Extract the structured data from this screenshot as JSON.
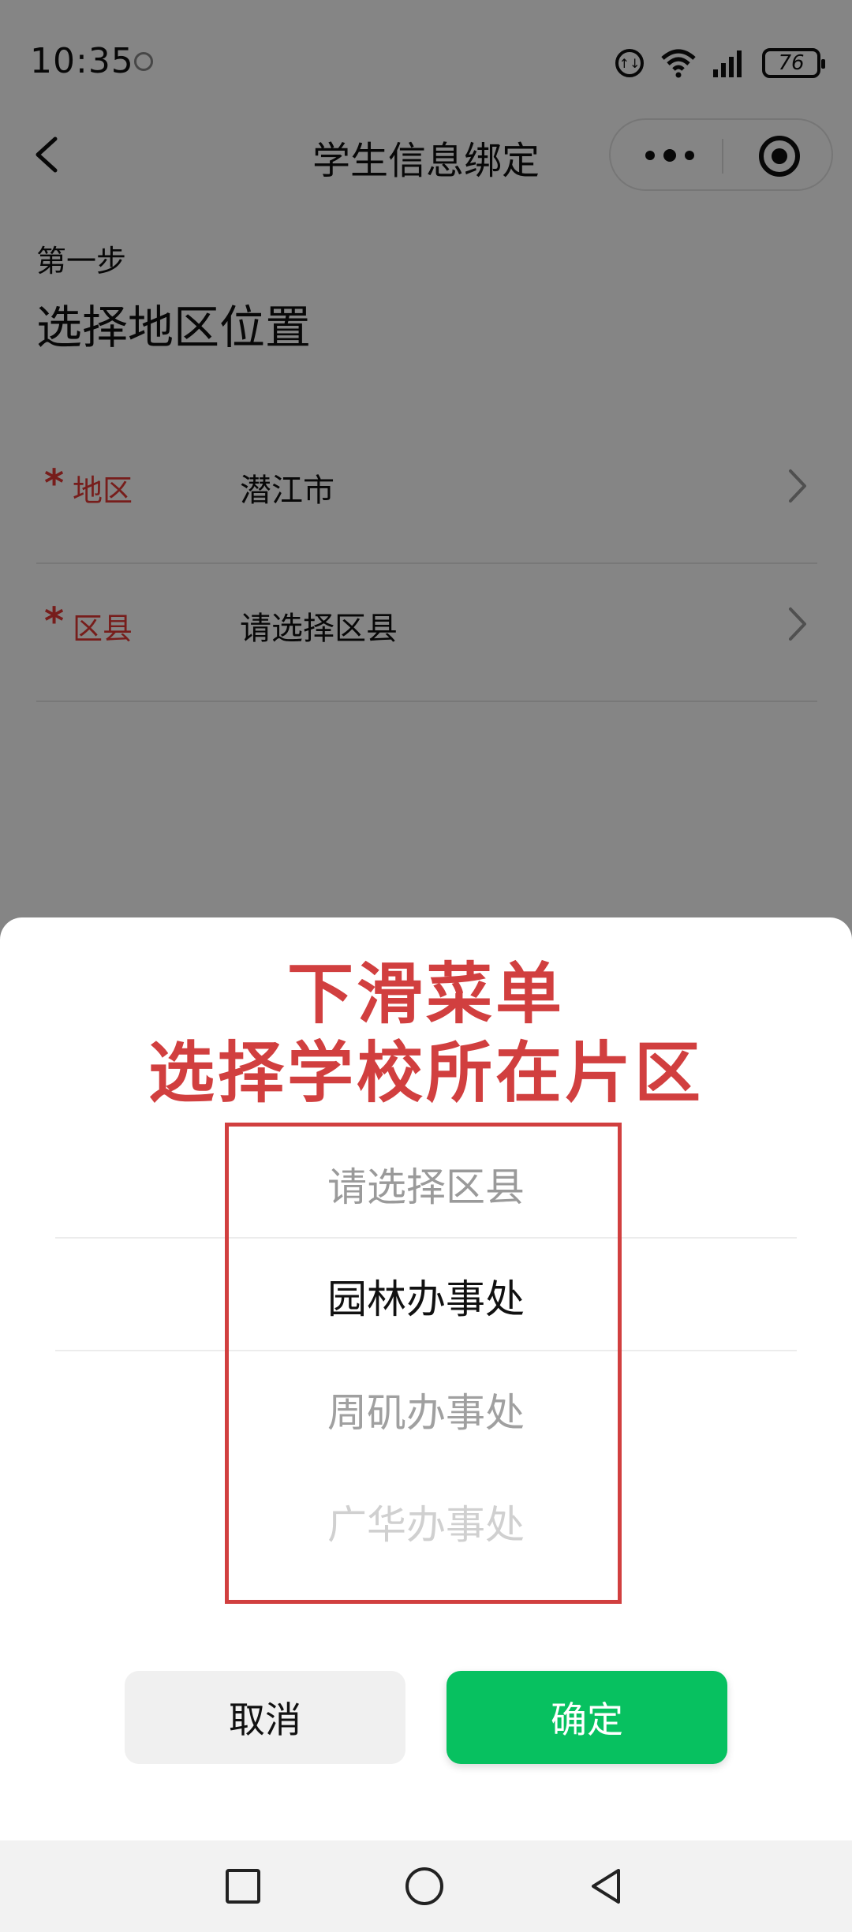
{
  "status_bar": {
    "time": "10:35",
    "battery": "76",
    "icons": [
      "notification-dot-icon",
      "data-speed-icon",
      "wifi-icon",
      "signal-icon",
      "battery-icon"
    ]
  },
  "nav": {
    "title": "学生信息绑定",
    "icons": [
      "back-chevron-icon",
      "more-dots-icon",
      "close-circle-icon"
    ]
  },
  "step": {
    "label": "第一步",
    "heading": "选择地区位置"
  },
  "form": {
    "rows": [
      {
        "required_mark": "*",
        "label": "地区",
        "value": "潜江市"
      },
      {
        "required_mark": "*",
        "label": "区县",
        "value": "请选择区县"
      }
    ]
  },
  "annotation": {
    "line1": "下滑菜单",
    "line2": "选择学校所在片区",
    "color": "#d13f3f"
  },
  "picker": {
    "options": [
      "请选择区县",
      "园林办事处",
      "周矶办事处",
      "广华办事处"
    ],
    "selected_index": 1
  },
  "buttons": {
    "cancel": "取消",
    "confirm": "确定"
  },
  "colors": {
    "accent_green": "#07c160",
    "required_red": "#e53935"
  },
  "system_nav": {
    "icons": [
      "recent-apps-square-icon",
      "home-circle-icon",
      "back-triangle-icon"
    ]
  }
}
